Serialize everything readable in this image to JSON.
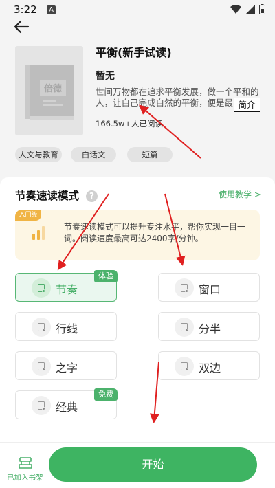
{
  "status_bar": {
    "time": "3:22",
    "notif_letter": "A"
  },
  "book": {
    "cover_text": "倍德",
    "title": "平衡(新手试读)",
    "author": "暂无",
    "description": "世间万物都在追求平衡发展，做一个平和的人，让自己完成自然的平衡，便是最",
    "intro_button": "简介",
    "readers": "166.5w+人已阅读",
    "tags": [
      "人文与教育",
      "白话文",
      "短篇"
    ]
  },
  "section": {
    "title": "节奏速读模式",
    "help_symbol": "?",
    "tutorial_link": "使用教学 >"
  },
  "info": {
    "badge": "入门级",
    "text": "节奏速读模式可以提升专注水平，帮你实现一目一词。阅读速度最高可达2400字/分钟。"
  },
  "modes": [
    {
      "label": "节奏",
      "badge": "体验",
      "selected": true
    },
    {
      "label": "窗口",
      "badge": "",
      "selected": false
    },
    {
      "label": "行线",
      "badge": "",
      "selected": false
    },
    {
      "label": "分半",
      "badge": "",
      "selected": false
    },
    {
      "label": "之字",
      "badge": "",
      "selected": false
    },
    {
      "label": "双边",
      "badge": "",
      "selected": false
    },
    {
      "label": "经典",
      "badge": "免费",
      "selected": false
    }
  ],
  "bottom": {
    "shelf_label": "已加入书架",
    "start_button": "开始"
  },
  "colors": {
    "accent_green": "#3eb462",
    "annotation_red": "#e02020",
    "info_bg": "#fdf6e4",
    "badge_orange": "#f0b445"
  }
}
